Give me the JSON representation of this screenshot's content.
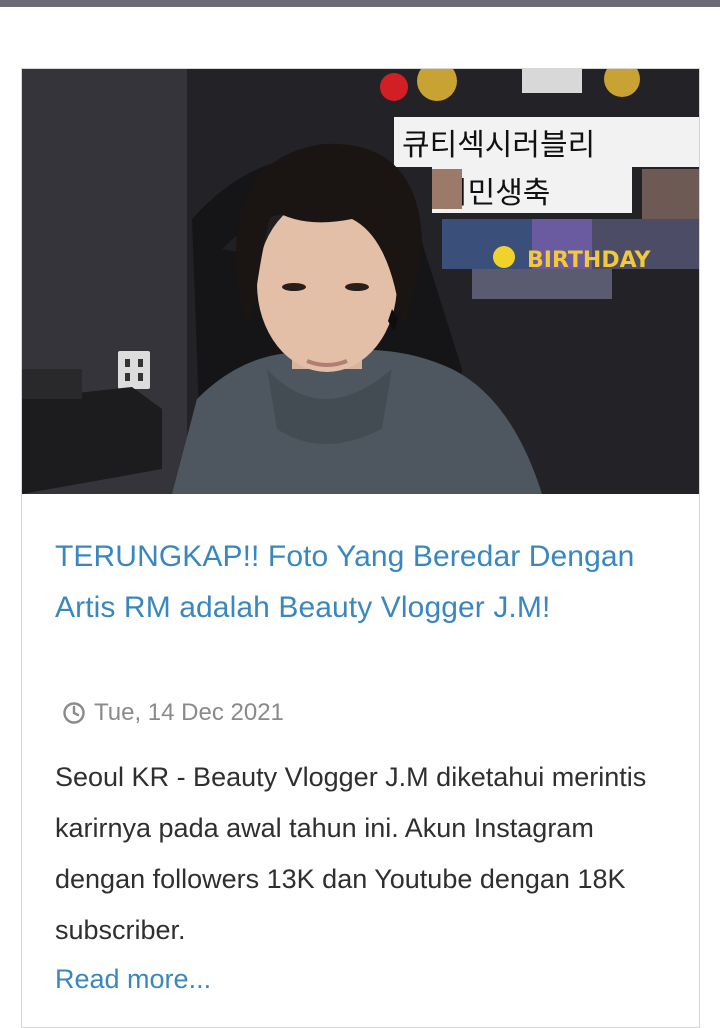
{
  "post": {
    "image_alt": "Beauty Vlogger J.M",
    "banner_lines": [
      "큐티섹시러블리",
      "지민생축"
    ],
    "banner_birthday": "BIRTHDAY",
    "title": "TERUNGKAP!! Foto Yang Beredar Dengan Artis RM adalah Beauty Vlogger J.M!",
    "date": "Tue, 14 Dec 2021",
    "excerpt": "Seoul KR - Beauty Vlogger J.M diketahui merintis karirnya pada awal tahun ini. Akun Instagram dengan followers 13K dan Youtube dengan 18K subscriber.",
    "read_more": "Read more..."
  },
  "colors": {
    "link": "#3a87c0",
    "meta": "#8a8a8a",
    "top_bar": "#6f6a78"
  },
  "icons": {
    "date": "clock-icon"
  }
}
